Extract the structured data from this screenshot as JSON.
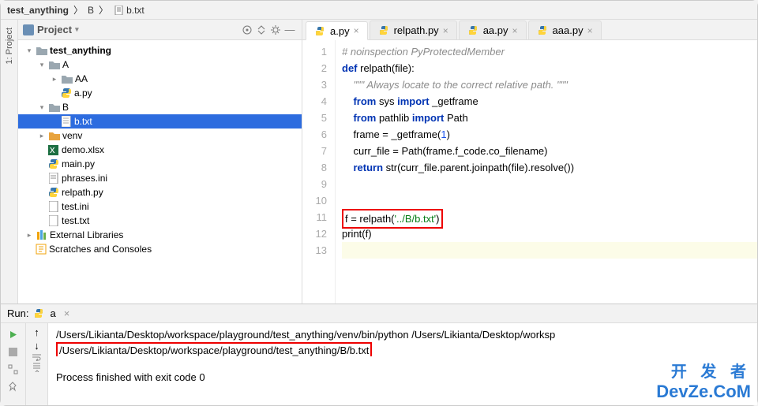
{
  "breadcrumb": {
    "root": "test_anything",
    "mid": "B",
    "file": "b.txt"
  },
  "sidebar": {
    "label": "1: Project"
  },
  "projectPanel": {
    "title": "Project"
  },
  "tree": {
    "root": "test_anything",
    "A": "A",
    "AA": "AA",
    "apy": "a.py",
    "B": "B",
    "btxt": "b.txt",
    "venv": "venv",
    "demo": "demo.xlsx",
    "main": "main.py",
    "phrases": "phrases.ini",
    "relpath": "relpath.py",
    "testini": "test.ini",
    "testtxt": "test.txt",
    "ext": "External Libraries",
    "scratch": "Scratches and Consoles"
  },
  "tabs": {
    "t0": "a.py",
    "t1": "relpath.py",
    "t2": "aa.py",
    "t3": "aaa.py"
  },
  "code": {
    "l1": "# noinspection PyProtectedMember",
    "l2a": "def",
    "l2b": " relpath(file):",
    "l3": "    \"\"\" Always locate to the correct relative path. \"\"\"",
    "l4a": "    ",
    "l4b": "from",
    "l4c": " sys ",
    "l4d": "import",
    "l4e": " _getframe",
    "l5a": "    ",
    "l5b": "from",
    "l5c": " pathlib ",
    "l5d": "import",
    "l5e": " Path",
    "l6a": "    frame = _getframe(",
    "l6b": "1",
    "l6c": ")",
    "l7": "    curr_file = Path(frame.f_code.co_filename)",
    "l8a": "    ",
    "l8b": "return",
    "l8c": " str(curr_file.parent.joinpath(file).resolve())",
    "l11a": "f = relpath(",
    "l11b": "'../B/b.txt'",
    "l11c": ")",
    "l12": "print(f)"
  },
  "gutterLines": [
    "1",
    "2",
    "3",
    "4",
    "5",
    "6",
    "7",
    "8",
    "9",
    "10",
    "11",
    "12",
    "13"
  ],
  "run": {
    "label": "Run:",
    "config": "a",
    "line1": "/Users/Likianta/Desktop/workspace/playground/test_anything/venv/bin/python /Users/Likianta/Desktop/worksp",
    "line2": "/Users/Likianta/Desktop/workspace/playground/test_anything/B/b.txt",
    "exit": "Process finished with exit code 0"
  },
  "watermark": {
    "l1": "开 发 者",
    "l2": "DevZe.CoM"
  }
}
